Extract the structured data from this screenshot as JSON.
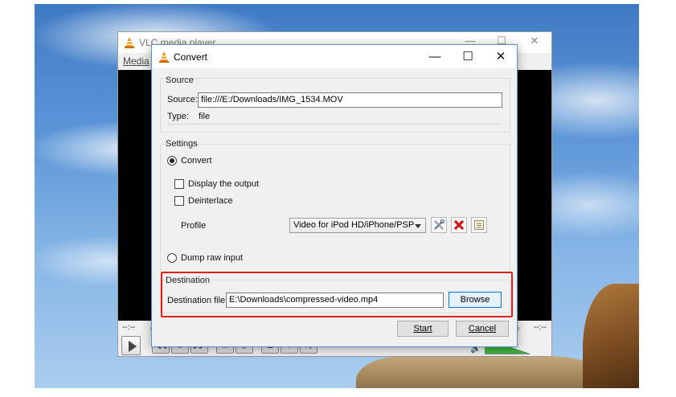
{
  "vlc_window": {
    "title": "VLC media player",
    "menu_media": "Media",
    "time_left": "--:--",
    "time_right": "--:--"
  },
  "dialog": {
    "title": "Convert",
    "minimize": "—",
    "maximize": "☐",
    "close": "✕"
  },
  "source": {
    "legend": "Source",
    "source_label": "Source:",
    "source_value": "file:///E:/Downloads/IMG_1534.MOV",
    "type_label": "Type:",
    "type_value": "file"
  },
  "settings": {
    "legend": "Settings",
    "convert_label": "Convert",
    "display_output_label": "Display the output",
    "deinterlace_label": "Deinterlace",
    "profile_label": "Profile",
    "profile_selected": "Video for iPod HD/iPhone/PSP",
    "dump_raw_label": "Dump raw input",
    "convert_selected": true,
    "display_output_checked": false,
    "deinterlace_checked": false
  },
  "destination": {
    "legend": "Destination",
    "file_label": "Destination file:",
    "file_value": "E:\\Downloads\\compressed-video.mp4",
    "browse_label": "Browse"
  },
  "buttons": {
    "start": "Start",
    "cancel": "Cancel"
  },
  "colors": {
    "highlight": "#e0201b",
    "volume": "#3db43d",
    "accent": "#0078d7"
  }
}
